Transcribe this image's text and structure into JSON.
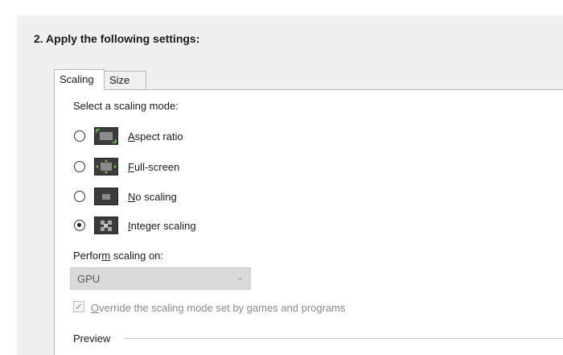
{
  "section": {
    "title": "2. Apply the following settings:"
  },
  "tabs": [
    {
      "label": "Scaling",
      "selected": true
    },
    {
      "label": "Size",
      "selected": false
    }
  ],
  "scaling_mode": {
    "heading": "Select a scaling mode:",
    "options": [
      {
        "label_first": "A",
        "label_rest": "spect ratio",
        "icon": "aspect-ratio-icon",
        "checked": false
      },
      {
        "label_first": "F",
        "label_rest": "ull-screen",
        "icon": "full-screen-icon",
        "checked": false
      },
      {
        "label_first": "N",
        "label_rest": "o scaling",
        "icon": "no-scaling-icon",
        "checked": false
      },
      {
        "label_first": "I",
        "label_rest": "nteger scaling",
        "icon": "integer-scaling-icon",
        "checked": true
      }
    ]
  },
  "perform_on": {
    "label_a": "Perfor",
    "label_u": "m",
    "label_b": " scaling on:",
    "value": "GPU"
  },
  "override": {
    "checked": true,
    "label_first": "O",
    "label_rest": "verride the scaling mode set by games and programs"
  },
  "preview": {
    "label": "Preview"
  },
  "colors": {
    "panel": "#f0f0f0",
    "disabled_select": "#d9d9d9",
    "icon_dark": "#3c3c3c"
  }
}
